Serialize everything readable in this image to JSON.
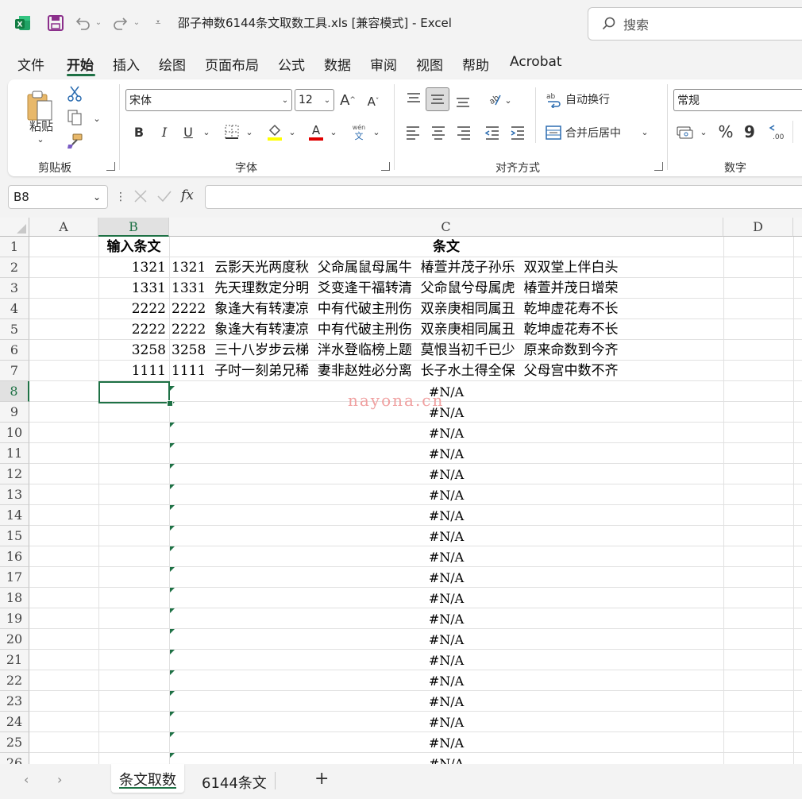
{
  "titlebar": {
    "title": "邵子神数6144条文取数工具.xls  [兼容模式]  -  Excel",
    "search_placeholder": "搜索"
  },
  "menu": [
    "文件",
    "开始",
    "插入",
    "绘图",
    "页面布局",
    "公式",
    "数据",
    "审阅",
    "视图",
    "帮助",
    "Acrobat"
  ],
  "ribbon": {
    "clipboard": {
      "paste_label": "粘贴",
      "group_label": "剪贴板"
    },
    "font": {
      "font_name": "宋体",
      "font_size": "12",
      "group_label": "字体",
      "bold": "B",
      "italic": "I",
      "underline": "U"
    },
    "alignment": {
      "wrap_text": "自动换行",
      "merge_center": "合并后居中",
      "group_label": "对齐方式"
    },
    "number": {
      "format": "常规",
      "percent": "%",
      "comma": "9",
      "group_label": "数字"
    }
  },
  "formula_bar": {
    "name_box": "B8",
    "fx": "fx",
    "content": ""
  },
  "columns": [
    "A",
    "B",
    "C",
    "D"
  ],
  "rows": [
    "1",
    "2",
    "3",
    "4",
    "5",
    "6",
    "7",
    "8",
    "9",
    "10",
    "11",
    "12",
    "13",
    "14",
    "15",
    "16",
    "17",
    "18",
    "19",
    "20",
    "21",
    "22",
    "23",
    "24",
    "25",
    "26"
  ],
  "sheet": {
    "header_b": "输入条文",
    "header_c": "条文",
    "data": [
      {
        "b": "1321",
        "c": "1321  云影天光两度秋  父命属鼠母属牛  椿萱并茂子孙乐  双双堂上伴白头"
      },
      {
        "b": "1331",
        "c": "1331  先天理数定分明  爻变逢干福转清  父命鼠兮母属虎  椿萱并茂日增荣"
      },
      {
        "b": "2222",
        "c": "2222  象逢大有转凄凉  中有代破主刑伤  双亲庚相同属丑  乾坤虚花寿不长"
      },
      {
        "b": "2222",
        "c": "2222  象逢大有转凄凉  中有代破主刑伤  双亲庚相同属丑  乾坤虚花寿不长"
      },
      {
        "b": "3258",
        "c": "3258  三十八岁步云梯  泮水登临榜上题  莫恨当初千已少  原来命数到今齐"
      },
      {
        "b": "1111",
        "c": "1111  子吋一刻弟兄稀  妻非赵姓必分离  长子水土得全保  父母宫中数不齐"
      }
    ],
    "na_value": "#N/A",
    "watermark": "nayona.cn"
  },
  "tabs": [
    "条文取数",
    "6144条文"
  ],
  "colors": {
    "accent": "#1e7145",
    "grid": "#e1e1e1"
  }
}
